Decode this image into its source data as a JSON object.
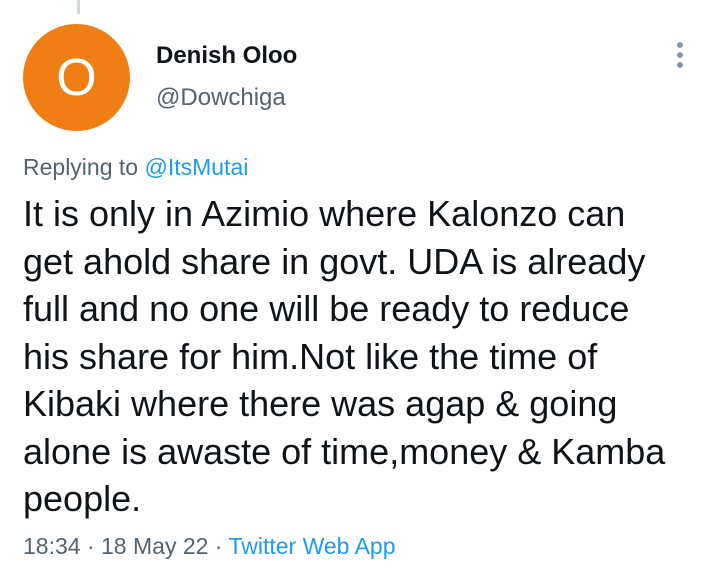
{
  "author": {
    "avatar_letter": "O",
    "avatar_color": "#f07e14",
    "display_name": "Denish Oloo",
    "handle": "@Dowchiga"
  },
  "reply": {
    "prefix": "Replying to ",
    "mention": "@ItsMutai"
  },
  "tweet": {
    "lines": [
      "It is only in Azimio where Kalonzo can",
      "get ahold share in govt. UDA is already",
      "full and no one will be ready to reduce",
      "his share for him.Not like the time of",
      "Kibaki where there was agap & going",
      "alone is awaste of time,money & Kamba",
      "people."
    ]
  },
  "meta": {
    "time": "18:34",
    "separator": " · ",
    "date": "18 May 22",
    "source": "Twitter Web App"
  },
  "icons": {
    "more": "more-vertical-icon"
  },
  "colors": {
    "link": "#1d9bf0",
    "secondary_text": "#536471",
    "primary_text": "#0f1419"
  }
}
